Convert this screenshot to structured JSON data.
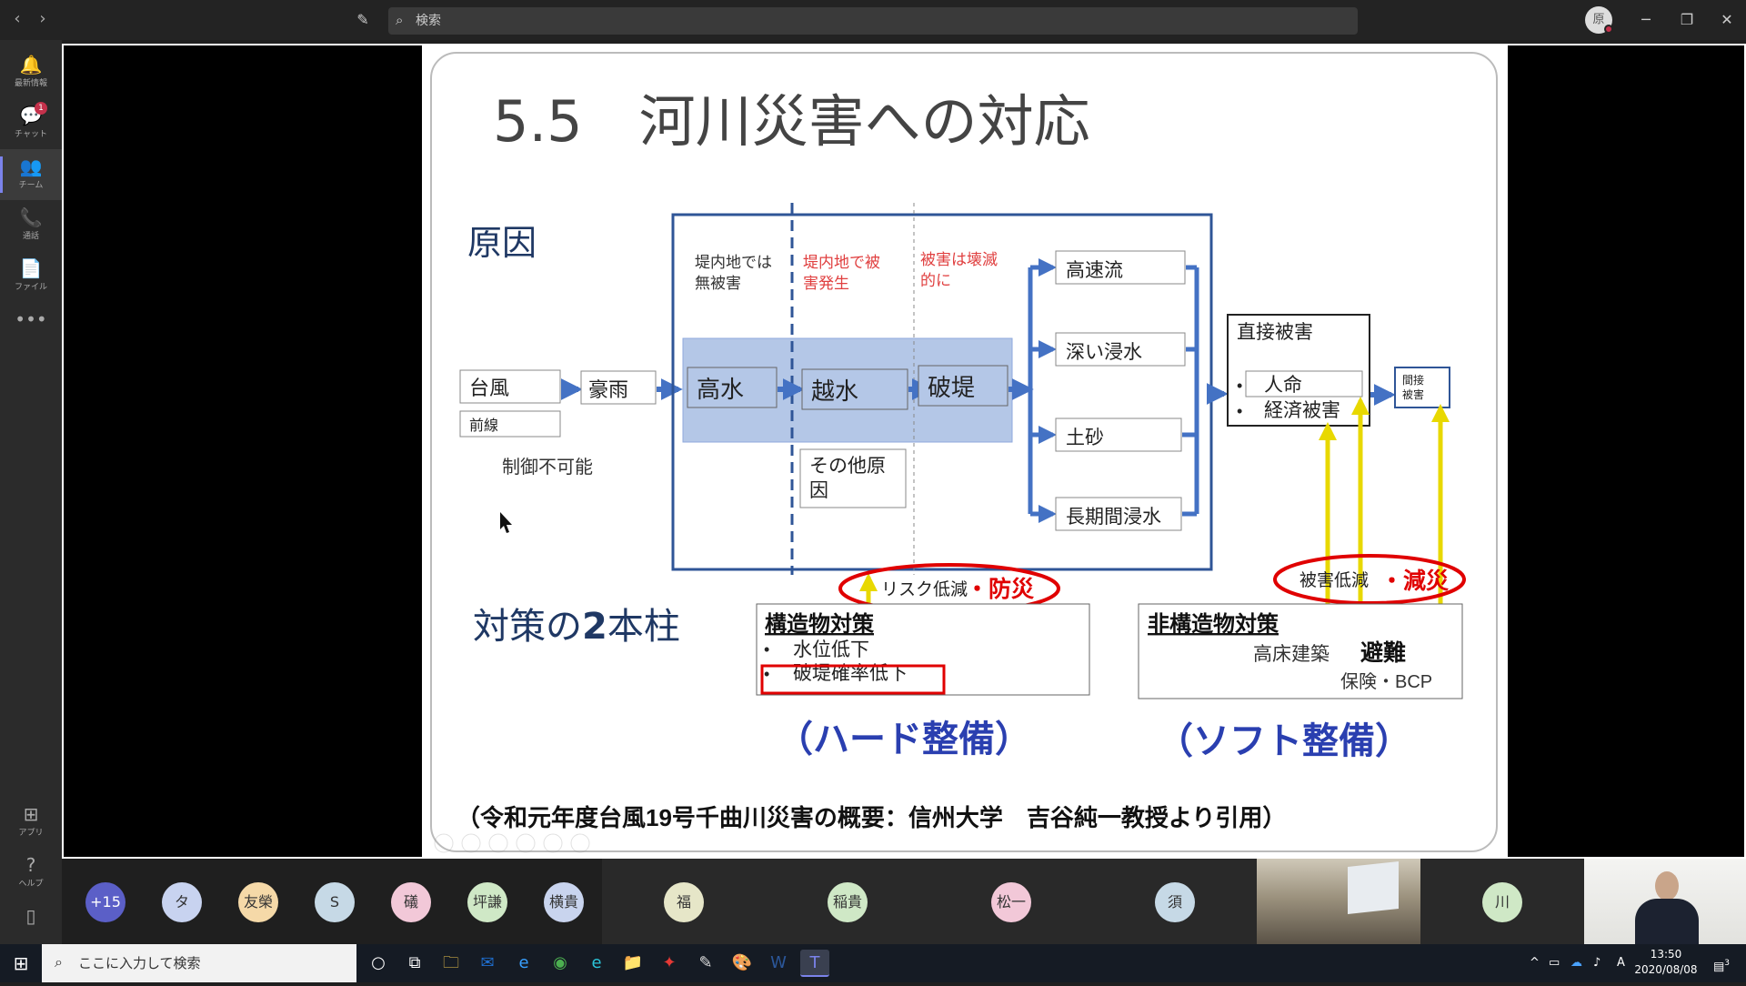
{
  "app": {
    "search_placeholder": "検索",
    "profile_initial": "原"
  },
  "rail": [
    {
      "icon": "bell-icon",
      "label": "最新情報",
      "glyph": "🔔"
    },
    {
      "icon": "chat-icon",
      "label": "チャット",
      "glyph": "💬",
      "badge": "1"
    },
    {
      "icon": "teams-icon",
      "label": "チーム",
      "glyph": "👥"
    },
    {
      "icon": "phone-icon",
      "label": "通話",
      "glyph": "📞"
    },
    {
      "icon": "file-icon",
      "label": "ファイル",
      "glyph": "📄"
    },
    {
      "icon": "more-icon",
      "label": "",
      "glyph": "•••"
    }
  ],
  "rail_bottom": [
    {
      "icon": "apps-icon",
      "label": "アプリ",
      "glyph": "⊞"
    },
    {
      "icon": "help-icon",
      "label": "ヘルプ",
      "glyph": "?"
    },
    {
      "icon": "device-icon",
      "label": "",
      "glyph": "▯"
    }
  ],
  "slide": {
    "title": "5.5　河川災害への対応",
    "cause_heading": "原因",
    "causes": {
      "typhoon": "台風",
      "front": "前線",
      "heavy_rain": "豪雨",
      "uncontrollable": "制御不可能"
    },
    "zones": {
      "no_damage": [
        "堤内地では",
        "無被害"
      ],
      "damage": [
        "堤内地で被",
        "害発生"
      ],
      "devastating": [
        "被害は壊滅",
        "的に"
      ]
    },
    "process": {
      "high_water": "高水",
      "overflow": "越水",
      "breach": "破堤",
      "other": [
        "その他原",
        "因"
      ]
    },
    "effects": [
      "高速流",
      "深い浸水",
      "土砂",
      "長期間浸水"
    ],
    "direct": {
      "heading": "直接被害",
      "items": [
        "人命",
        "経済被害"
      ]
    },
    "indirect": [
      "間接",
      "被害"
    ],
    "risk_reduction": "リスク低減",
    "prevention": "・防災",
    "damage_reduction": "被害低減",
    "mitigation": "・減災",
    "measures_heading_a": "対策の",
    "measures_heading_b": "2",
    "measures_heading_c": "本柱",
    "structural": {
      "heading": "構造物対策",
      "items": [
        "水位低下",
        "破堤確率低下"
      ]
    },
    "non_structural": {
      "heading": "非構造物対策",
      "item1": "高床建築",
      "item2": "避難",
      "item3": "保険・BCP"
    },
    "hard": "（ハード整備）",
    "soft": "（ソフト整備）",
    "citation": "（令和元年度台風19号千曲川災害の概要：信州大学　吉谷純一教授より引用）"
  },
  "participants": [
    {
      "initials": "+15",
      "color": "#5b5fc7",
      "text_color": "#ffffff"
    },
    {
      "initials": "タ",
      "color": "#c8d3f0"
    },
    {
      "initials": "友榮",
      "color": "#f5d9a8"
    },
    {
      "initials": "S",
      "color": "#c6d9e6"
    },
    {
      "initials": "礒",
      "color": "#f2c8d8"
    },
    {
      "initials": "坪謙",
      "color": "#cfe8c6"
    },
    {
      "initials": "横貴",
      "color": "#c9d4ee"
    }
  ],
  "tiles": [
    {
      "initials": "福",
      "color": "#e6e6c8"
    },
    {
      "initials": "稲貴",
      "color": "#cfe8c6"
    },
    {
      "initials": "松一",
      "color": "#f2c8d8"
    },
    {
      "initials": "須",
      "color": "#c6d9e6"
    },
    {
      "initials": "川",
      "color": "#cfe8c6"
    }
  ],
  "taskbar": {
    "search_placeholder": "ここに入力して検索",
    "icons": [
      "cortana-icon",
      "task-view-icon",
      "explorer-icon",
      "outlook-icon",
      "ie-icon",
      "chrome-icon",
      "edge-icon",
      "folder-icon",
      "pdf-icon",
      "notepad-icon",
      "paint-icon",
      "word-icon",
      "teams-icon"
    ],
    "time": "13:50",
    "date": "2020/08/08",
    "ime": "A",
    "notifications": "3"
  }
}
